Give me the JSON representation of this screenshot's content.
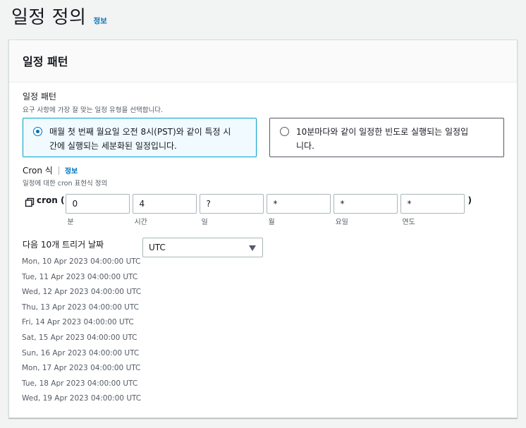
{
  "header": {
    "title": "일정 정의",
    "info": "정보"
  },
  "panel": {
    "title": "일정 패턴"
  },
  "pattern": {
    "label": "일정 패턴",
    "description": "요구 사항에 가장 잘 맞는 일정 유형을 선택합니다.",
    "options": [
      {
        "line1": "매월 첫 번째 월요일 오전 8시(PST)와 같이 특정 시",
        "line2": "간에 실행되는 세분화된 일정입니다.",
        "selected": true
      },
      {
        "line1": "10분마다와 같이 일정한 빈도로 실행되는 일정입",
        "line2": "니다.",
        "selected": false
      }
    ]
  },
  "cron": {
    "label": "Cron 식",
    "info": "정보",
    "description": "일정에 대한 cron 표현식 정의",
    "prefix": "cron (",
    "suffix": ")",
    "fields": [
      {
        "value": "0",
        "label": "분"
      },
      {
        "value": "4",
        "label": "시간"
      },
      {
        "value": "?",
        "label": "일"
      },
      {
        "value": "*",
        "label": "월"
      },
      {
        "value": "*",
        "label": "요일"
      },
      {
        "value": "*",
        "label": "연도"
      }
    ]
  },
  "next_triggers": {
    "label": "다음 10개 트리거 날짜",
    "timezone": "UTC",
    "dates": [
      "Mon, 10 Apr 2023 04:00:00 UTC",
      "Tue, 11 Apr 2023 04:00:00 UTC",
      "Wed, 12 Apr 2023 04:00:00 UTC",
      "Thu, 13 Apr 2023 04:00:00 UTC",
      "Fri, 14 Apr 2023 04:00:00 UTC",
      "Sat, 15 Apr 2023 04:00:00 UTC",
      "Sun, 16 Apr 2023 04:00:00 UTC",
      "Mon, 17 Apr 2023 04:00:00 UTC",
      "Tue, 18 Apr 2023 04:00:00 UTC",
      "Wed, 19 Apr 2023 04:00:00 UTC"
    ]
  },
  "icons": {
    "copy": "copy-icon",
    "caret": "caret-down-icon",
    "radio": "radio-icon"
  },
  "colors": {
    "link": "#0073bb",
    "selected_border": "#00a1c9",
    "selected_bg": "#f1faff",
    "page_bg": "#f2f3f3"
  }
}
